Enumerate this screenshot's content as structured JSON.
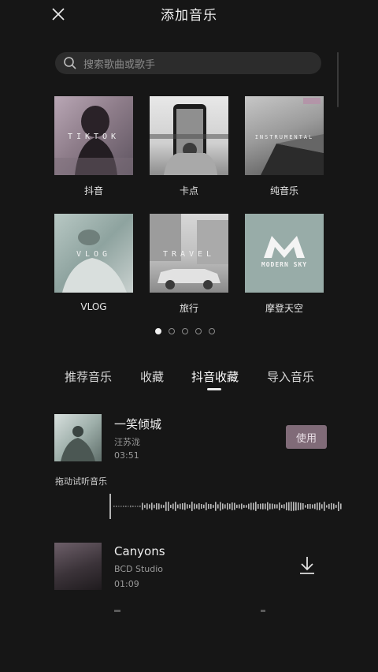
{
  "header": {
    "title": "添加音乐",
    "close_icon": "close-icon"
  },
  "search": {
    "placeholder": "搜索歌曲或歌手"
  },
  "categories": [
    {
      "label": "抖音",
      "thumb_text": "TIKTOK"
    },
    {
      "label": "卡点",
      "thumb_text": ""
    },
    {
      "label": "纯音乐",
      "thumb_text": "INSTRUMENTAL"
    },
    {
      "label": "VLOG",
      "thumb_text": "VLOG"
    },
    {
      "label": "旅行",
      "thumb_text": "TRAVEL"
    },
    {
      "label": "摩登天空",
      "thumb_text": "MODERN SKY"
    }
  ],
  "pagination": {
    "total": 5,
    "active": 1
  },
  "tabs": [
    {
      "label": "推荐音乐",
      "active": false
    },
    {
      "label": "收藏",
      "active": false
    },
    {
      "label": "抖音收藏",
      "active": true
    },
    {
      "label": "导入音乐",
      "active": false
    }
  ],
  "songs": [
    {
      "name": "一笑倾城",
      "artist": "汪苏泷",
      "duration": "03:51",
      "action": "使用"
    },
    {
      "name": "Canyons",
      "artist": "BCD Studio",
      "duration": "01:09",
      "action_icon": "download-icon"
    }
  ],
  "preview_hint": "拖动试听音乐",
  "colors": {
    "background": "#161616",
    "use_button": "#806b78",
    "accent_text": "#ffffff"
  }
}
